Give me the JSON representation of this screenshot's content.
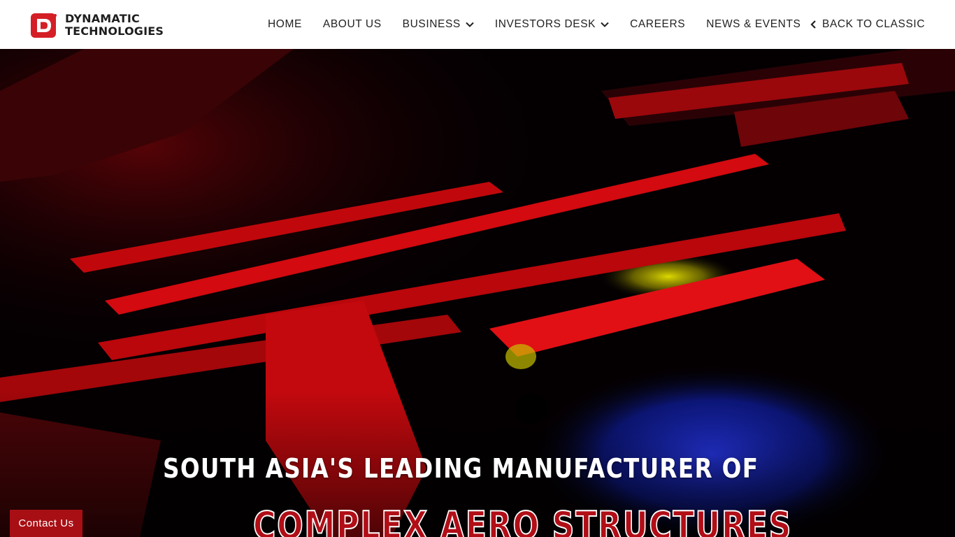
{
  "brand": {
    "line1": "DYNAMATIC",
    "line2": "TECHNOLOGIES",
    "color": "#d41f26"
  },
  "nav": {
    "items": [
      {
        "label": "HOME",
        "dropdown": false
      },
      {
        "label": "ABOUT US",
        "dropdown": false
      },
      {
        "label": "BUSINESS",
        "dropdown": true
      },
      {
        "label": "INVESTORS DESK",
        "dropdown": true
      },
      {
        "label": "CAREERS",
        "dropdown": false
      },
      {
        "label": "NEWS & EVENTS",
        "dropdown": false
      }
    ],
    "back_label": "BACK TO CLASSIC"
  },
  "hero": {
    "headline": "SOUTH ASIA'S LEADING MANUFACTURER OF",
    "subline": "COMPLEX AERO STRUCTURES"
  },
  "contact": {
    "label": "Contact Us",
    "color": "#a80f14"
  }
}
